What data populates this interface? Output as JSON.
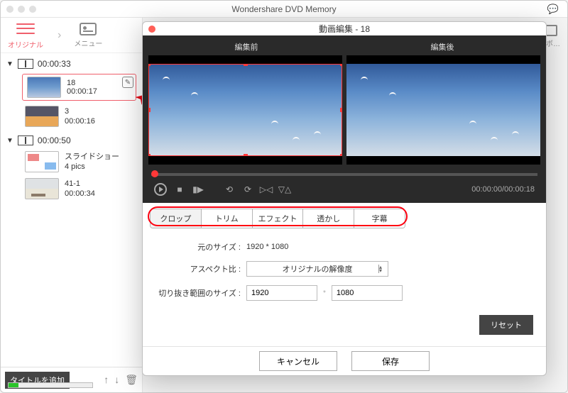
{
  "app": {
    "title": "Wondershare DVD Memory"
  },
  "side_tabs": {
    "original": "オリジナル",
    "menu": "メニュー"
  },
  "ext_tool": "ルボ…",
  "groups": [
    {
      "duration": "00:00:33",
      "items": [
        {
          "name": "18",
          "duration": "00:00:17",
          "thumb": "sky",
          "selected": true,
          "edit_icon": true
        },
        {
          "name": "3",
          "duration": "00:00:16",
          "thumb": "road"
        }
      ]
    },
    {
      "duration": "00:00:50",
      "items": [
        {
          "name": "スライドショー",
          "duration": "4 pics",
          "thumb": "slide"
        },
        {
          "name": "41-1",
          "duration": "00:00:34",
          "thumb": "beach"
        }
      ]
    }
  ],
  "bottom": {
    "add_title": "タイトルを追加"
  },
  "editor": {
    "title": "動画編集 - 18",
    "before": "編集前",
    "after": "編集後",
    "timecode": "00:00:00/00:00:18",
    "tabs": [
      "クロップ",
      "トリム",
      "エフェクト",
      "透かし",
      "字幕"
    ],
    "active_tab": 0,
    "labels": {
      "orig_size": "元のサイズ :",
      "orig_size_val": "1920 * 1080",
      "aspect": "アスペクト比 :",
      "aspect_val": "オリジナルの解像度",
      "crop_size": "切り抜き範囲のサイズ :",
      "crop_w": "1920",
      "crop_h": "1080",
      "reset": "リセット",
      "cancel": "キャンセル",
      "save": "保存"
    }
  }
}
